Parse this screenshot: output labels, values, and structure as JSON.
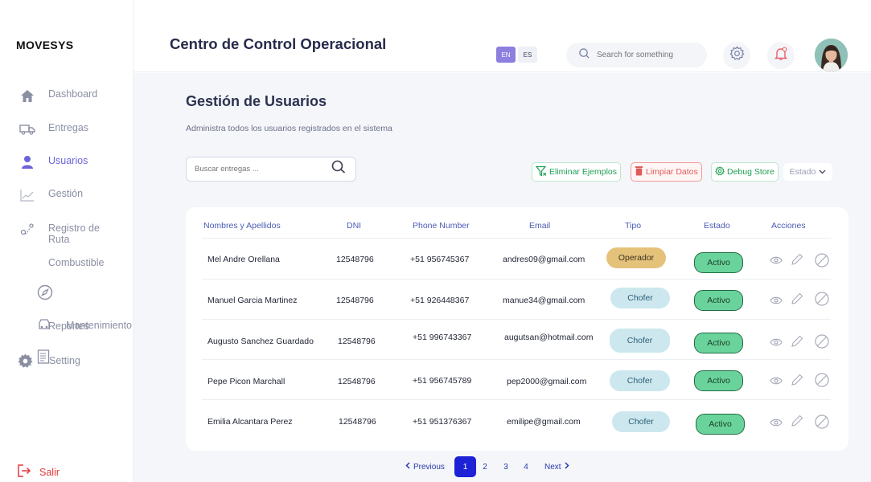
{
  "app": {
    "logo": "MOVESYS"
  },
  "sidebar": {
    "items": [
      {
        "label": "Dashboard"
      },
      {
        "label": "Entregas"
      },
      {
        "label": "Usuarios"
      },
      {
        "label": "Gestión"
      },
      {
        "label": "Registro de Ruta"
      }
    ],
    "sub_combustible": "Combustible",
    "overlap_reportes": "Reportes",
    "overlap_mantenimiento": "Mantenimiento",
    "setting": "Setting",
    "logout": "Salir"
  },
  "header": {
    "title": "Centro de Control Operacional",
    "lang_en": "EN",
    "lang_es": "ES",
    "search_placeholder": "Search for something"
  },
  "main": {
    "title": "Gestión de Usuarios",
    "subtitle": "Administra todos los  usuarios registrados en el sistema",
    "search_placeholder": "Buscar entregas ...",
    "actions": {
      "eliminar": "Eliminar Ejemplos",
      "limpiar": "Limpiar Datos",
      "debug": "Debug Store",
      "estado": "Estado"
    }
  },
  "table": {
    "columns": [
      "Nombres y Apellidos",
      "DNI",
      "Phone Number",
      "Email",
      "Tipo",
      "Estado",
      "Acciones"
    ],
    "rows": [
      {
        "name": "Mel Andre Orellana",
        "dni": "12548796",
        "phone": "+51 956745367",
        "email": "andres09@gmail.com",
        "tipo": "Operador",
        "estado": "Activo"
      },
      {
        "name": "Manuel Garcia Martinez",
        "dni": "12548796",
        "phone": "+51 926448367",
        "email": "manue34@gmail.com",
        "tipo": "Chofer",
        "estado": "Activo"
      },
      {
        "name": "Augusto Sanchez Guardado",
        "dni": "12548796",
        "phone": "+51 996743367",
        "email": "augutsan@hotmail.com",
        "tipo": "Chofer",
        "estado": "Activo"
      },
      {
        "name": "Pepe Picon Marchall",
        "dni": "12548796",
        "phone": "+51 956745789",
        "email": "pep2000@gmail.com",
        "tipo": "Chofer",
        "estado": "Activo"
      },
      {
        "name": "Emilia Alcantara Perez",
        "dni": "12548796",
        "phone": "+51 951376367",
        "email": "emilipe@gmail.com",
        "tipo": "Chofer",
        "estado": "Activo"
      }
    ]
  },
  "pagination": {
    "previous": "Previous",
    "pages": [
      "1",
      "2",
      "3",
      "4"
    ],
    "next": "Next",
    "current": "1"
  },
  "colors": {
    "accent": "#6c63d9",
    "active_page": "#1e22d6",
    "logout": "#e5383b",
    "estado_bg": "#6ad39b"
  }
}
